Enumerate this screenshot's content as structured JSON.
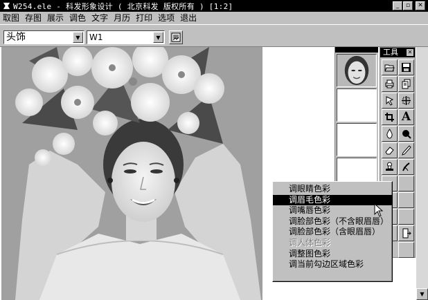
{
  "window": {
    "title": "W254.ele - 科发形象设计  ( 北京科发  版权所有 ) [1:2]",
    "app_icon": "app-icon",
    "controls": {
      "minimize": "_",
      "maximize": "▫",
      "close": "✕"
    }
  },
  "menu": {
    "items": [
      {
        "label": "取图"
      },
      {
        "label": "存图"
      },
      {
        "label": "展示"
      },
      {
        "label": "调色"
      },
      {
        "label": "文字"
      },
      {
        "label": "月历"
      },
      {
        "label": "打印"
      },
      {
        "label": "选项"
      },
      {
        "label": "退出"
      }
    ]
  },
  "toolbar": {
    "category_combo": {
      "value": "头饰"
    },
    "style_combo": {
      "value": "W1"
    },
    "preview_button": {
      "icon": "image-preview-icon"
    }
  },
  "thumbnails": {
    "count": 4,
    "first_icon": "face-thumbnail"
  },
  "tools_panel": {
    "title": "工具",
    "close_glyph": "✕",
    "tools": [
      {
        "name": "open-file-icon"
      },
      {
        "name": "save-disk-icon"
      },
      {
        "name": "print-icon"
      },
      {
        "name": "copy-pages-icon"
      },
      {
        "name": "lasso-select-icon"
      },
      {
        "name": "move-cross-icon"
      },
      {
        "name": "crop-icon"
      },
      {
        "name": "text-tool-icon",
        "glyph": "A"
      },
      {
        "name": "drop-icon"
      },
      {
        "name": "brush-dot-icon"
      },
      {
        "name": "eraser-icon"
      },
      {
        "name": "pencil-icon"
      },
      {
        "name": "stamp-icon"
      },
      {
        "name": "smudge-icon"
      }
    ]
  },
  "context_menu": {
    "items": [
      {
        "label": "调眼睛色彩",
        "state": "normal"
      },
      {
        "label": "调眉毛色彩",
        "state": "selected"
      },
      {
        "label": "调嘴唇色彩",
        "state": "normal"
      },
      {
        "label": "调脸部色彩（不含眼眉唇）",
        "state": "normal"
      },
      {
        "label": "调脸部色彩（含眼眉唇）",
        "state": "normal"
      },
      {
        "label": "调人体色彩",
        "state": "disabled"
      },
      {
        "label": "调整图色彩",
        "state": "normal"
      },
      {
        "label": "调当前勾边区域色彩",
        "state": "normal"
      }
    ]
  },
  "colors": {
    "titlebar": "#000000",
    "face": "#c0c0c0",
    "highlight": "#000000",
    "workspace": "#ffffff"
  }
}
